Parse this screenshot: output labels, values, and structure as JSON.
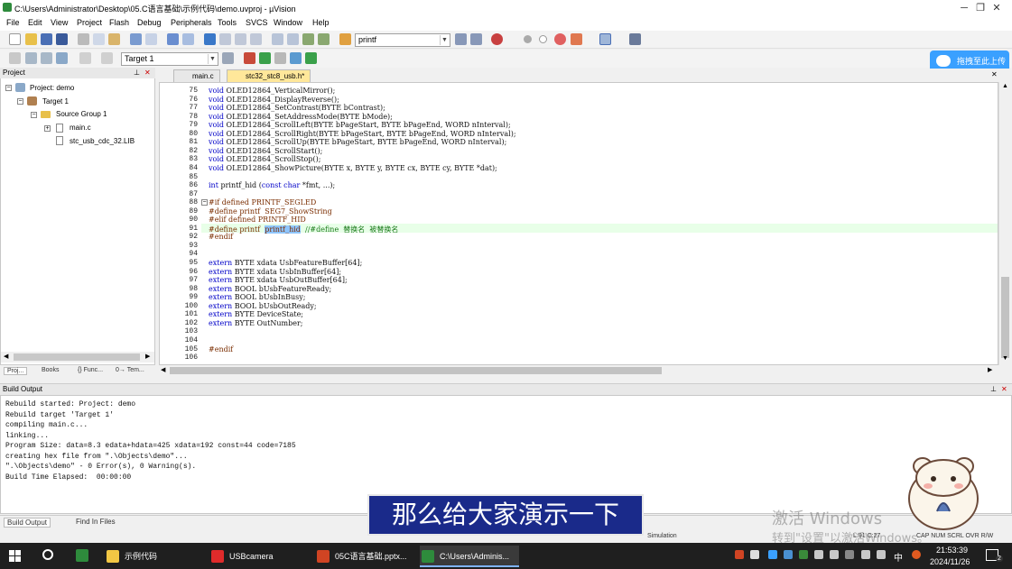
{
  "window": {
    "title": "C:\\Users\\Administrator\\Desktop\\05.C语言基础\\示例代码\\demo.uvproj - µVision",
    "controls": [
      "─",
      "❐",
      "✕"
    ]
  },
  "menu": [
    "File",
    "Edit",
    "View",
    "Project",
    "Flash",
    "Debug",
    "Peripherals",
    "Tools",
    "SVCS",
    "Window",
    "Help"
  ],
  "toolbar": {
    "find_combo": "printf",
    "target_combo": "Target 1"
  },
  "upload_button": "拖拽至此上传",
  "project_panel": {
    "title": "Project",
    "tree": {
      "root": "Project: demo",
      "target": "Target 1",
      "group": "Source Group 1",
      "files": [
        "main.c",
        "stc_usb_cdc_32.LIB"
      ]
    },
    "tabs": [
      "Proj...",
      "Books",
      "{} Func...",
      "0→ Tem..."
    ]
  },
  "editor": {
    "tabs": [
      {
        "label": "main.c",
        "active": false
      },
      {
        "label": "stc32_stc8_usb.h*",
        "active": true
      }
    ],
    "highlighted_line": 91,
    "lines": [
      {
        "n": "75",
        "t": "void OLED12864_VerticalMirror();"
      },
      {
        "n": "76",
        "t": "void OLED12864_DisplayReverse();"
      },
      {
        "n": "77",
        "t": "void OLED12864_SetContrast(BYTE bContrast);"
      },
      {
        "n": "78",
        "t": "void OLED12864_SetAddressMode(BYTE bMode);"
      },
      {
        "n": "79",
        "t": "void OLED12864_ScrollLeft(BYTE bPageStart, BYTE bPageEnd, WORD nInterval);"
      },
      {
        "n": "80",
        "t": "void OLED12864_ScrollRight(BYTE bPageStart, BYTE bPageEnd, WORD nInterval);"
      },
      {
        "n": "81",
        "t": "void OLED12864_ScrollUp(BYTE bPageStart, BYTE bPageEnd, WORD nInterval);"
      },
      {
        "n": "82",
        "t": "void OLED12864_ScrollStart();"
      },
      {
        "n": "83",
        "t": "void OLED12864_ScrollStop();"
      },
      {
        "n": "84",
        "t": "void OLED12864_ShowPicture(BYTE x, BYTE y, BYTE cx, BYTE cy, BYTE *dat);"
      },
      {
        "n": "85",
        "t": ""
      },
      {
        "n": "86",
        "t": "int printf_hid (const char *fmt, ...);"
      },
      {
        "n": "87",
        "t": ""
      },
      {
        "n": "88",
        "t": "#if defined PRINTF_SEGLED"
      },
      {
        "n": "89",
        "t": "#define printf  SEG7_ShowString"
      },
      {
        "n": "90",
        "t": "#elif defined PRINTF_HID"
      },
      {
        "n": "91",
        "t": "#define printf  printf_hid  //#define  替换名  被替换名"
      },
      {
        "n": "92",
        "t": "#endif"
      },
      {
        "n": "93",
        "t": ""
      },
      {
        "n": "94",
        "t": ""
      },
      {
        "n": "95",
        "t": "extern BYTE xdata UsbFeatureBuffer[64];"
      },
      {
        "n": "96",
        "t": "extern BYTE xdata UsbInBuffer[64];"
      },
      {
        "n": "97",
        "t": "extern BYTE xdata UsbOutBuffer[64];"
      },
      {
        "n": "98",
        "t": "extern BOOL bUsbFeatureReady;"
      },
      {
        "n": "99",
        "t": "extern BOOL bUsbInBusy;"
      },
      {
        "n": "100",
        "t": "extern BOOL bUsbOutReady;"
      },
      {
        "n": "101",
        "t": "extern BYTE DeviceState;"
      },
      {
        "n": "102",
        "t": "extern BYTE OutNumber;"
      },
      {
        "n": "103",
        "t": ""
      },
      {
        "n": "104",
        "t": ""
      },
      {
        "n": "105",
        "t": "#endif"
      },
      {
        "n": "106",
        "t": ""
      }
    ]
  },
  "build_output": {
    "title": "Build Output",
    "lines": [
      "Rebuild started: Project: demo",
      "Rebuild target 'Target 1'",
      "compiling main.c...",
      "linking...",
      "Program Size: data=8.3 edata+hdata=425 xdata=192 const=44 code=7185",
      "creating hex file from \".\\Objects\\demo\"...",
      "\".\\Objects\\demo\" - 0 Error(s), 0 Warning(s).",
      "Build Time Elapsed:  00:00:00"
    ],
    "tabs": [
      "Build Output",
      "Find In Files"
    ]
  },
  "status": {
    "mode": "Simulation",
    "position": "L:91 C:27",
    "caps": "CAP NUM SCRL OVR R/W"
  },
  "subtitle": "那么给大家演示一下",
  "watermark": {
    "line1": "激活 Windows",
    "line2": "转到\"设置\"以激活Windows。"
  },
  "taskbar": {
    "items": [
      {
        "label": "示例代码",
        "color": "#f2c744",
        "active": false
      },
      {
        "label": "USBcamera",
        "color": "#e02b2b",
        "active": false
      },
      {
        "label": "05C语言基础.pptx...",
        "color": "#d04423",
        "active": false
      },
      {
        "label": "C:\\Users\\Adminis...",
        "color": "#2e8b3c",
        "active": true
      }
    ],
    "ime": "中",
    "time": "21:53:39",
    "date": "2024/11/26",
    "notifications": "2"
  }
}
